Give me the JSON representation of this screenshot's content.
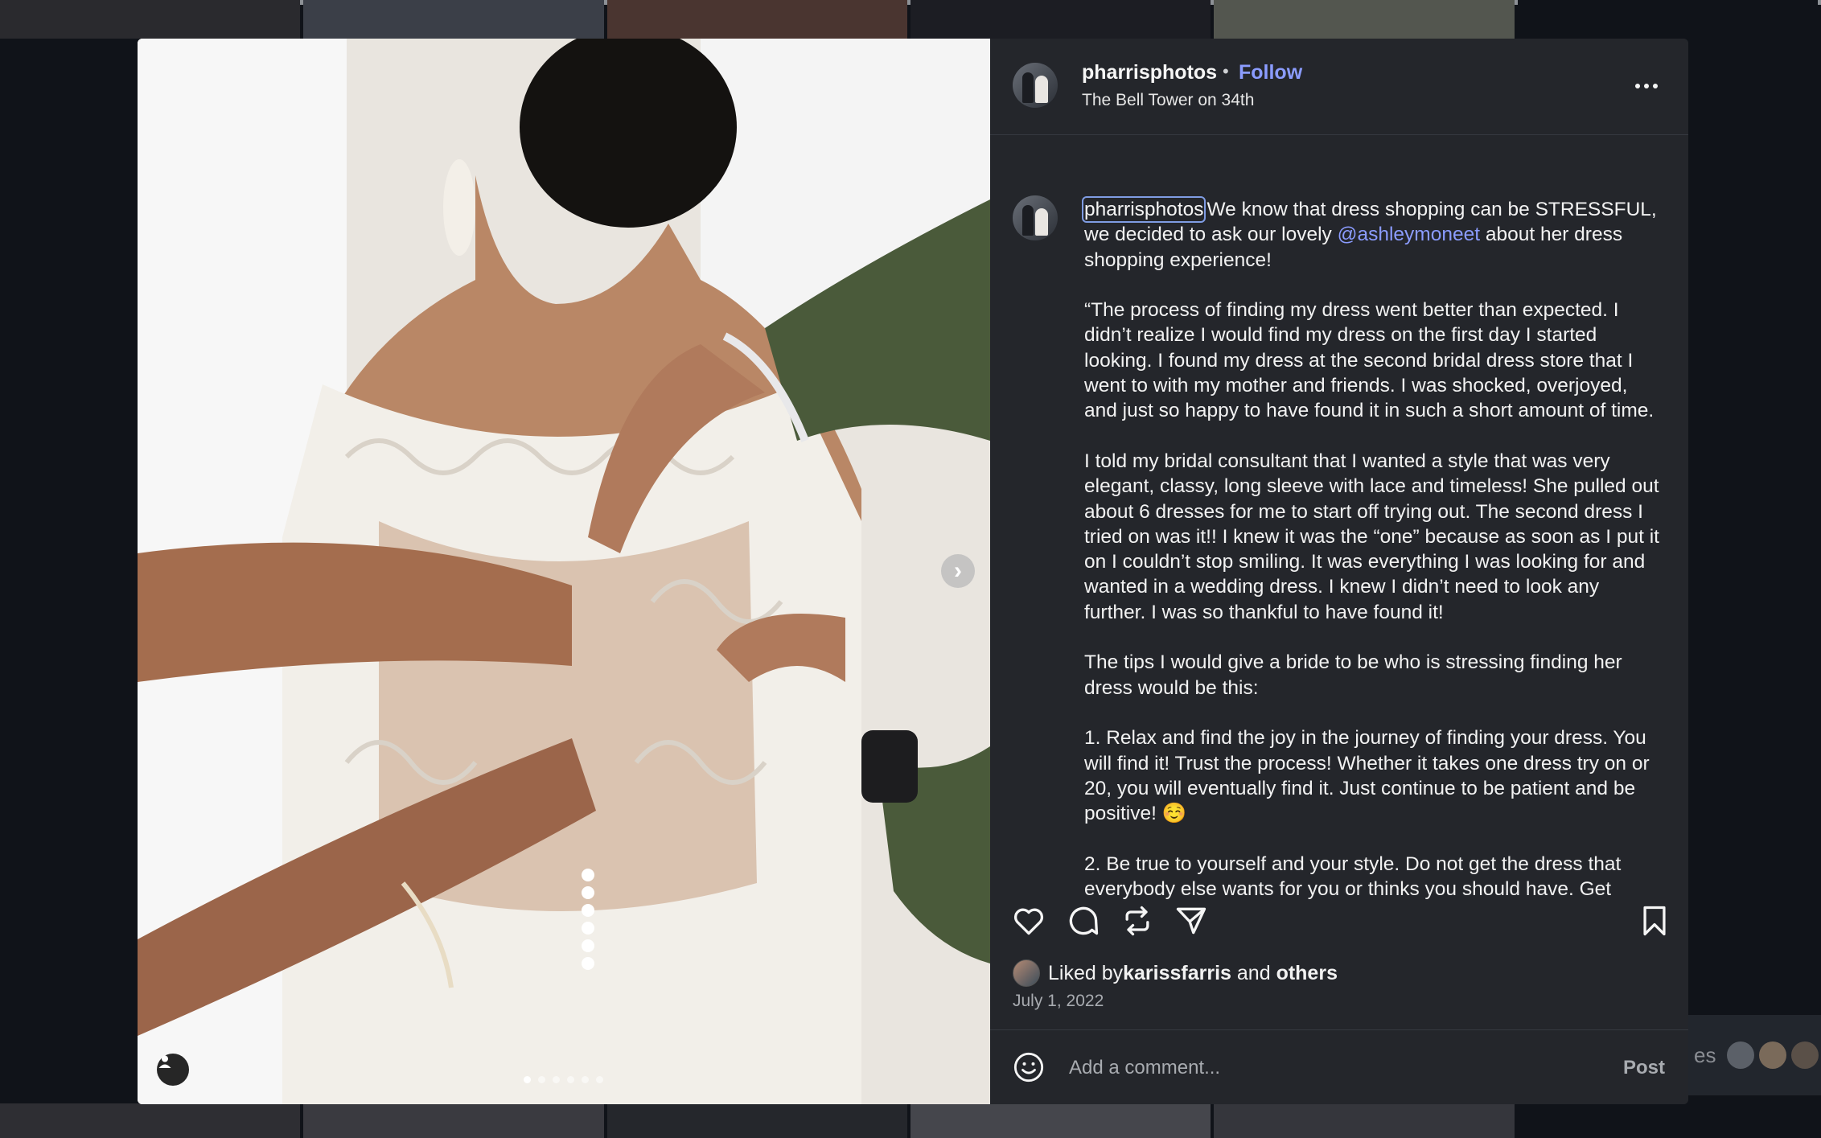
{
  "post": {
    "username": "pharrisphotos",
    "separator": "•",
    "follow_label": "Follow",
    "location": "The Bell Tower on 34th",
    "caption_username": "pharrisphotos",
    "caption_part1": "We know that dress shopping can be STRESSFUL, we decided to ask our lovely ",
    "caption_mention": "@ashleymoneet",
    "caption_part2": " about her dress shopping experience!\n\n“The process of finding my dress went better than expected. I didn’t realize I would find my dress on the first day I started looking. I found my dress at the second bridal dress store that I went to with my mother and friends. I was shocked, overjoyed, and just so happy to have found it in such a short amount of time.\n\nI told my bridal consultant that I wanted a style that was very elegant, classy, long sleeve with lace and timeless! She pulled out about 6 dresses for me to start off trying out. The second dress I tried on was it!! I knew it was the “one” because as soon as I put it on I couldn’t stop smiling. It was everything I was looking for and wanted in a wedding dress. I knew I didn’t need to look any further. I was so thankful to have found it!\n\nThe tips I would give a bride to be who is stressing finding her dress would be this:\n\n1. Relax and find the joy in the journey of finding your dress. You will find it! Trust the process! Whether it takes one dress try on or 20, you will eventually find it. Just continue to be patient and be positive! ☺️\n\n2. Be true to yourself and your style. Do not get the dress that everybody else wants for you or thinks you should have. Get",
    "liked_prefix": "Liked by ",
    "liked_user": "karissfarris",
    "liked_and": " and ",
    "liked_others": "others",
    "date": "July 1, 2022"
  },
  "comment": {
    "placeholder": "Add a comment...",
    "post_label": "Post"
  },
  "carousel": {
    "slide_count": 6,
    "active_index": 0
  },
  "background": {
    "partial_text": "es"
  },
  "colors": {
    "accent": "#8b9cff",
    "panel_bg": "#24262b",
    "page_bg": "#101319"
  },
  "icons": {
    "heart": "heart-icon",
    "comment": "comment-icon",
    "repost": "repost-icon",
    "share": "share-icon",
    "bookmark": "bookmark-icon",
    "emoji": "emoji-icon",
    "next": "chevron-right-icon",
    "tag": "user-tag-icon",
    "more": "more-icon"
  }
}
